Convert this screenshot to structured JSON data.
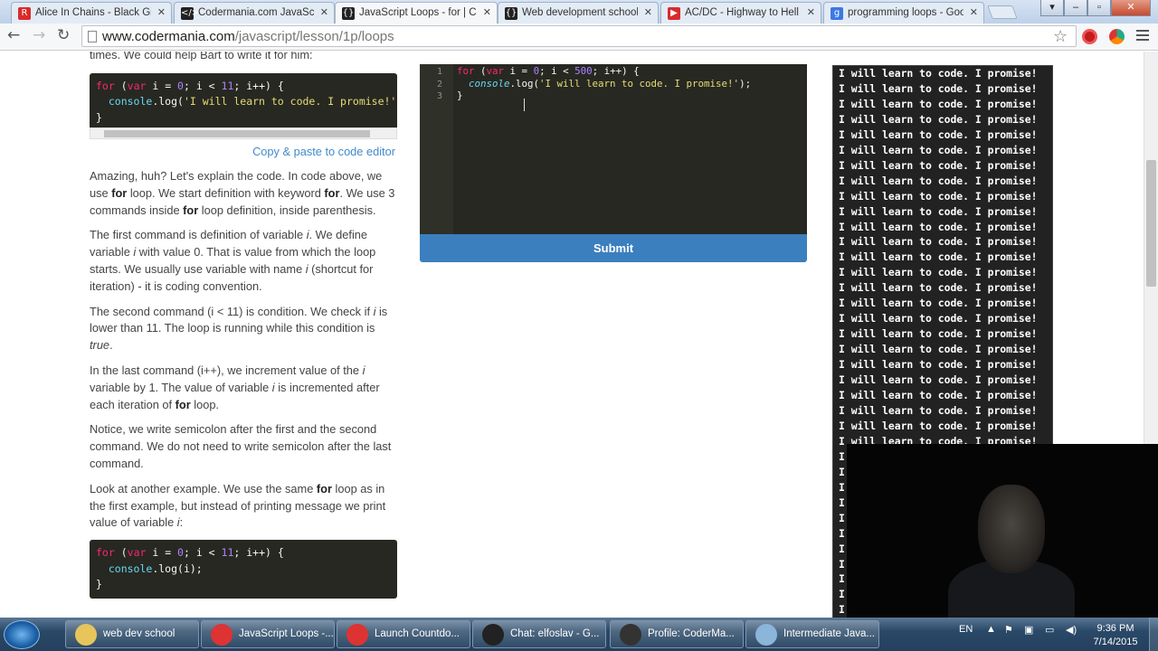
{
  "tabs": [
    {
      "title": "Alice In Chains - Black Giv",
      "icon": "youtube-icon",
      "color": "#d92b2b",
      "glyph": "R"
    },
    {
      "title": "Codermania.com JavaScri",
      "icon": "code-favicon-icon",
      "color": "#222",
      "glyph": "</>"
    },
    {
      "title": "JavaScript Loops - for | Co",
      "icon": "braces-favicon-icon",
      "color": "#222",
      "glyph": "{}"
    },
    {
      "title": "Web development school",
      "icon": "braces-favicon-icon",
      "color": "#222",
      "glyph": "{}"
    },
    {
      "title": "AC/DC - Highway to Hell",
      "icon": "youtube-icon",
      "color": "#d92b2b",
      "glyph": "▶"
    },
    {
      "title": "programming loops - Goo",
      "icon": "google-icon",
      "color": "#3b78e7",
      "glyph": "g"
    }
  ],
  "address": {
    "host": "www.codermania.com",
    "path": "/javascript/lesson/1p/loops"
  },
  "article": {
    "intro": "times. We could help Bart to write it for him:",
    "code1": [
      "for (var i = 0; i < 11; i++) {",
      "  console.log('I will learn to code. I promise!')",
      "}"
    ],
    "copy_link": "Copy & paste to code editor",
    "p1": [
      "Amazing, huh? Let's explain the code. In code above, we use ",
      "for",
      " loop. We start definition with keyword ",
      "for",
      ". We use 3 commands inside ",
      "for",
      " loop definition, inside parenthesis."
    ],
    "p2": [
      "The first command is definition of variable ",
      "i",
      ". We define variable ",
      "i",
      " with value 0. That is value from which the loop starts. We usually use variable with name ",
      "i",
      " (shortcut for iteration) - it is coding convention."
    ],
    "p3": [
      "The second command (i < 11) is condition. We check if ",
      "i",
      " is lower than 11. The loop is running while this condition is ",
      "true",
      "."
    ],
    "p4": [
      "In the last command (i++), we increment value of the ",
      "i",
      " variable by 1. The value of variable ",
      "i",
      " is incremented after each iteration of ",
      "for",
      " loop."
    ],
    "p5": "Notice, we write semicolon after the first and the second command. We do not need to write semicolon after the last command.",
    "p6": [
      "Look at another example. We use the same ",
      "for",
      " loop as in the first example, but instead of printing message we print value of variable ",
      "i",
      ":"
    ],
    "code2": [
      "for (var i = 0; i < 11; i++) {",
      "  console.log(i);",
      "}"
    ]
  },
  "editor": {
    "line_numbers": [
      "1",
      "2",
      "3"
    ],
    "lines": [
      "for (var i = 0; i < 500; i++) {",
      "  console.log('I will learn to code. I promise!');",
      "}"
    ],
    "submit_label": "Submit"
  },
  "console": {
    "line": "I will learn to code. I promise!",
    "first_line": "I will learn to code. I promise!"
  },
  "taskbar": {
    "items": [
      {
        "label": "web dev school",
        "icon": "folder-icon",
        "color": "#e8c55a"
      },
      {
        "label": "JavaScript Loops -...",
        "icon": "chrome-icon",
        "color": "#d33"
      },
      {
        "label": "Launch Countdo...",
        "icon": "chrome-icon",
        "color": "#d33"
      },
      {
        "label": "Chat: elfoslav - G...",
        "icon": "code-app-icon",
        "color": "#222"
      },
      {
        "label": "Profile: CoderMa...",
        "icon": "obs-icon",
        "color": "#333"
      },
      {
        "label": "Intermediate Java...",
        "icon": "document-icon",
        "color": "#8bb5d9"
      }
    ],
    "lang": "EN",
    "time": "9:36 PM",
    "date": "7/14/2015"
  }
}
